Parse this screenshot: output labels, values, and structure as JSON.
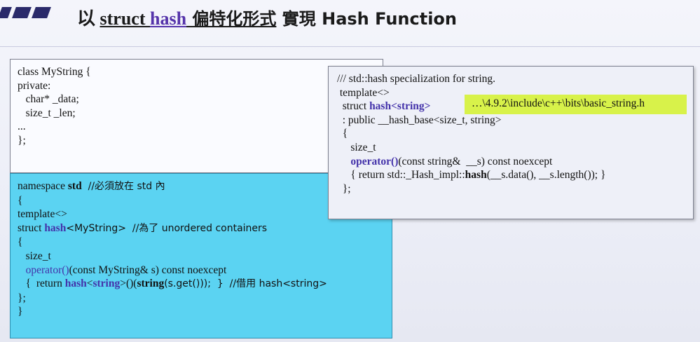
{
  "title": {
    "p1": "以 ",
    "p2": "struct",
    "p3": " ",
    "p4": "hash",
    "p5": " 偏特化形式",
    "p6": " 實現 Hash Function"
  },
  "class_box": {
    "lines": [
      "class MyString {",
      "private:",
      "   char* _data;",
      "   size_t _len;",
      "...",
      "};"
    ]
  },
  "std_box": {
    "l1a": "namespace ",
    "l1b": "std",
    "l1c": "  //必須放在 std 內",
    "l2": "{",
    "l3": "template<>",
    "l4a": "struct ",
    "l4b": "hash",
    "l4c": "<MyString>  //為了 unordered containers",
    "l5": "{",
    "l6": "   size_t",
    "l7a": "   operator()",
    "l7b": "(const MyString& s) const noexcept",
    "l8a": "   {  return ",
    "l8b": "hash",
    "l8c": "<",
    "l8d": "string",
    "l8e": ">()(",
    "l8f": "string",
    "l8g": "(s.get()));  }  //借用 hash<string>",
    "l9": "};",
    "l10": "}"
  },
  "spec_box": {
    "l1": "/// std::hash specialization for string.",
    "l2": " template<>",
    "l3a": "  struct ",
    "l3b": "hash<string>",
    "l4": "  : public __hash_base<size_t, string>",
    "l5": "  {",
    "l6": "     size_t",
    "l7a": "     operator()",
    "l7b": "(const string&  __s) const noexcept",
    "l8a": "     { return std::_Hash_impl::",
    "l8b": "hash",
    "l8c": "(__s.data(), __s.length()); }",
    "l9": "  };",
    "path": "…\\4.9.2\\include\\c++\\bits\\basic_string.h"
  }
}
